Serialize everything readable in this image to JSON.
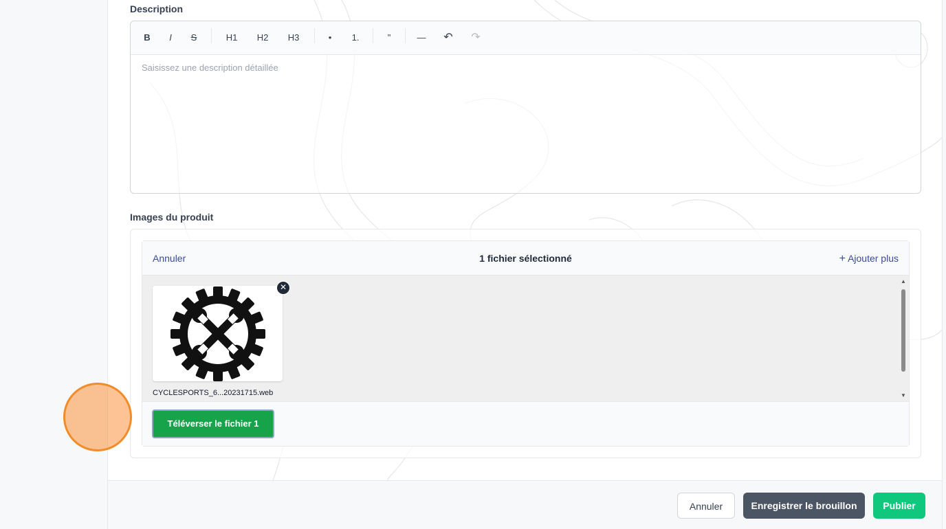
{
  "description": {
    "label": "Description",
    "placeholder": "Saisissez une description détaillée",
    "toolbar": {
      "bold": "B",
      "italic": "I",
      "strike": "S",
      "h1": "H1",
      "h2": "H2",
      "h3": "H3",
      "bullet": "•",
      "ordered": "1.",
      "quote": "\"",
      "hr": "—",
      "undo": "↶",
      "redo": "↷"
    }
  },
  "images": {
    "label": "Images du produit",
    "uploader": {
      "cancel": "Annuler",
      "count_text": "1 fichier sélectionné",
      "add_more": "Ajouter plus",
      "add_icon": "plus-icon",
      "file": {
        "name": "CYCLESPORTS_6...20231715.web",
        "thumbnail_icon": "gear-wrench-icon"
      },
      "upload_button": "Téléverser le fichier 1"
    }
  },
  "footer": {
    "cancel": "Annuler",
    "save_draft": "Enregistrer le brouillon",
    "publish": "Publier"
  },
  "colors": {
    "upload_green": "#16a34a",
    "publish_green": "#10c77e",
    "draft_gray": "#4b5563",
    "link_blue": "#3b4a9b",
    "click_highlight": "#f28c28"
  }
}
